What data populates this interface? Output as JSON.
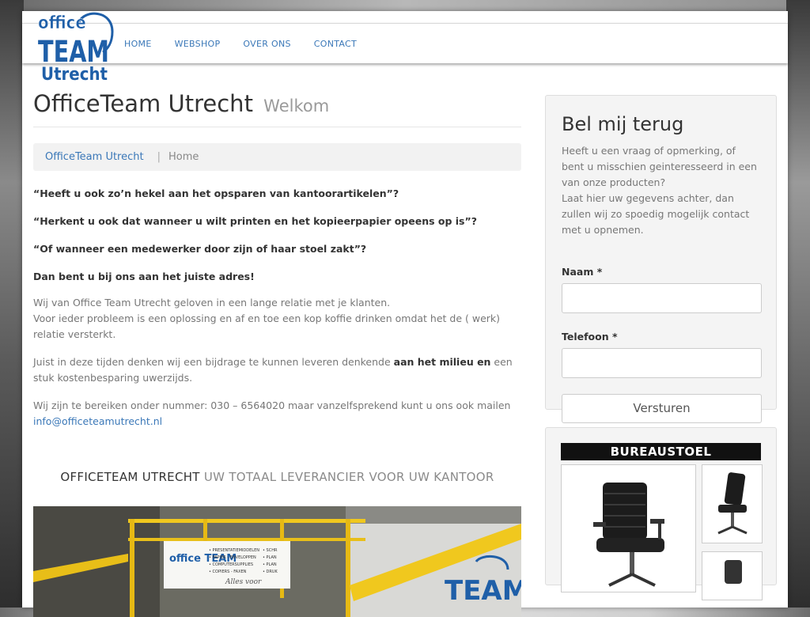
{
  "nav": {
    "items": [
      "HOME",
      "WEBSHOP",
      "OVER ONS",
      "CONTACT"
    ]
  },
  "logo": {
    "line1": "office",
    "line2": "TEAM",
    "line3": "Utrecht"
  },
  "header": {
    "title": "OfficeTeam Utrecht",
    "subtitle": "Welkom"
  },
  "breadcrumb": {
    "link": "OfficeTeam Utrecht",
    "separator": "|",
    "current": "Home"
  },
  "content": {
    "questions": [
      "“Heeft u ook zo’n hekel aan het opsparen van kantoorartikelen”?",
      "“Herkent u ook dat wanneer u wilt printen en het kopieerpapier opeens op is”?",
      "“Of wanneer een medewerker door zijn of haar stoel zakt”?",
      "Dan bent u bij ons aan het juiste adres!"
    ],
    "para1_line1": "Wij van Office Team Utrecht geloven in een lange relatie met je klanten.",
    "para1_line2": "Voor ieder probleem is een oplossing en af en toe een kop koffie drinken omdat het de ( werk) relatie versterkt.",
    "para2_before": "Juist in deze tijden denken wij een bijdrage te kunnen leveren denkende ",
    "para2_bold": "aan het milieu en",
    "para2_after": " een stuk kostenbesparing uwerzijds.",
    "para3_text": "Wij zijn te bereiken onder nummer: 030 – 6564020 maar vanzelfsprekend kunt u ons ook mailen ",
    "para3_email": "info@officeteamutrecht.nl",
    "slogan_dark": "OFFICETEAM UTRECHT",
    "slogan_light": "UW TOTAAL LEVERANCIER VOOR UW KANTOOR"
  },
  "photo": {
    "sign_logo": "office TEAM",
    "sign_list": [
      "• PRESENTATIEMIDDELEN",
      "• PAPIER - ENVELOPPEN",
      "• COMPUTERSUPPLIES",
      "• COPIERS - FAXEN"
    ],
    "sign_list2": [
      "• SCHR",
      "• PLAN",
      "• PLAN",
      "• DRUK"
    ],
    "sign_tagline": "Alles voor",
    "wall_text": "TEAM"
  },
  "sidebar": {
    "title": "Bel mij terug",
    "intro_line1": "Heeft u een vraag of opmerking, of bent u misschien geinteresseerd in een van onze producten?",
    "intro_line2": "Laat hier uw gegevens achter, dan zullen wij zo spoedig mogelijk contact met u opnemen.",
    "name_label": "Naam *",
    "phone_label": "Telefoon *",
    "submit_label": "Versturen",
    "product_banner": "BUREAUSTOEL"
  },
  "colors": {
    "accent": "#3b78b8",
    "text": "#333333",
    "muted": "#777777"
  }
}
